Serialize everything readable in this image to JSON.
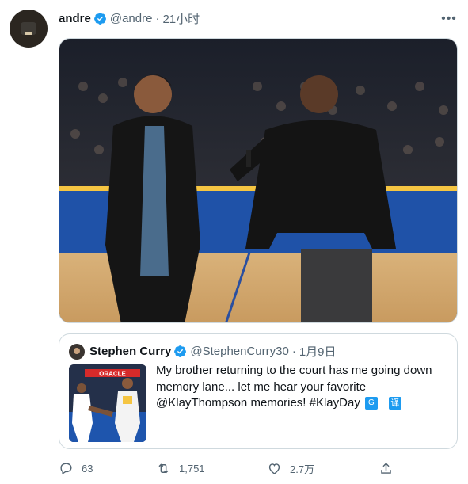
{
  "author": {
    "name": "andre",
    "handle": "@andre",
    "time": "21小时"
  },
  "more_label": "•••",
  "media": {
    "description": "photo"
  },
  "quoted": {
    "name": "Stephen Curry",
    "handle": "@StephenCurry30",
    "date": "1月9日",
    "text": "My brother returning to the court has me going down memory lane... let me hear your favorite @KlayThompson memories! #KlayDay",
    "thumb_sign": "ORACLE",
    "translate_g": "G",
    "translate_zh": "译"
  },
  "actions": {
    "replies": "63",
    "retweets": "1,751",
    "likes": "2.7万",
    "share": ""
  },
  "colors": {
    "accent": "#1d9bf0",
    "muted": "#536471",
    "border": "#cfd9de"
  }
}
